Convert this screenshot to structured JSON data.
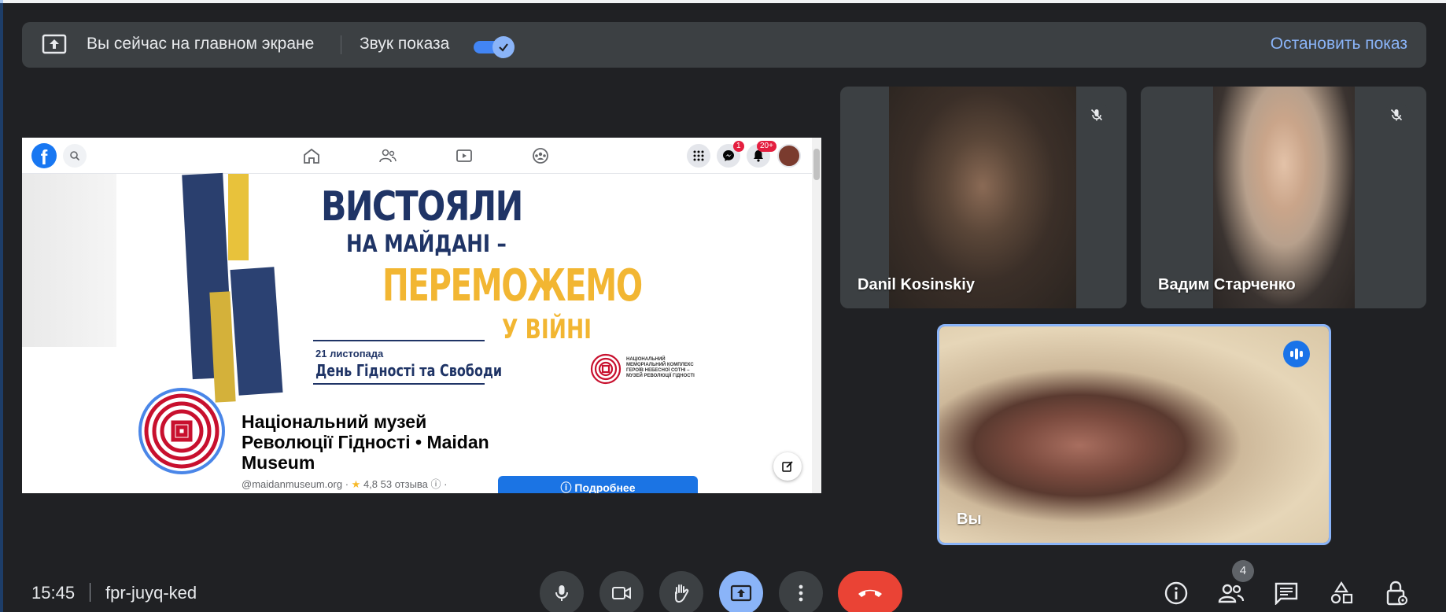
{
  "banner": {
    "home_text": "Вы сейчас на главном экране",
    "sound_label": "Звук показа",
    "sound_on": true,
    "stop_label": "Остановить показ"
  },
  "shared_screen": {
    "facebook": {
      "logo": "f",
      "messenger_badge": "1",
      "notifications_badge": "20+"
    },
    "cover": {
      "line1": "ВИСТОЯЛИ",
      "line2": "НА МАЙДАНІ –",
      "line3": "ПЕРЕМОЖЕМО",
      "line4": "У ВІЙНІ",
      "date": "21 листопада",
      "day_name": "День Гідності та Свободи",
      "logo_text": "НАЦІОНАЛЬНИЙ МЕМОРІАЛЬНИЙ КОМПЛЕКС ГЕРОЇВ НЕБЕСНОЇ СОТНІ – МУЗЕЙ РЕВОЛЮЦІЇ ГІДНОСТІ"
    },
    "page": {
      "name": "Національний музей Революції Гідності • Maidan Museum",
      "handle": "@maidanmuseum.org ·",
      "rating": "4,8",
      "reviews": "53 отзыва",
      "trailing": "·",
      "more_button": "Подробнее"
    }
  },
  "participants": [
    {
      "name": "Danil Kosinskiy",
      "muted": true
    },
    {
      "name": "Вадим Старченко",
      "muted": true
    },
    {
      "name": "Вы",
      "speaking": true
    }
  ],
  "bottom": {
    "time": "15:45",
    "meeting_code": "fpr-juyq-ked",
    "people_count": "4"
  },
  "colors": {
    "background": "#202124",
    "surface": "#3c4043",
    "accent": "#8ab4f8",
    "leave": "#ea4335",
    "facebook": "#1877f2"
  },
  "icons": [
    "present-to-all-icon",
    "check-icon",
    "home-icon",
    "friends-icon",
    "watch-icon",
    "groups-icon",
    "grid-menu-icon",
    "messenger-icon",
    "bell-icon",
    "search-icon",
    "edit-icon",
    "mic-off-icon",
    "speaking-icon",
    "mic-icon",
    "camera-icon",
    "raise-hand-icon",
    "more-vert-icon",
    "call-end-icon",
    "info-icon",
    "people-icon",
    "chat-icon",
    "activities-icon",
    "host-controls-icon"
  ]
}
